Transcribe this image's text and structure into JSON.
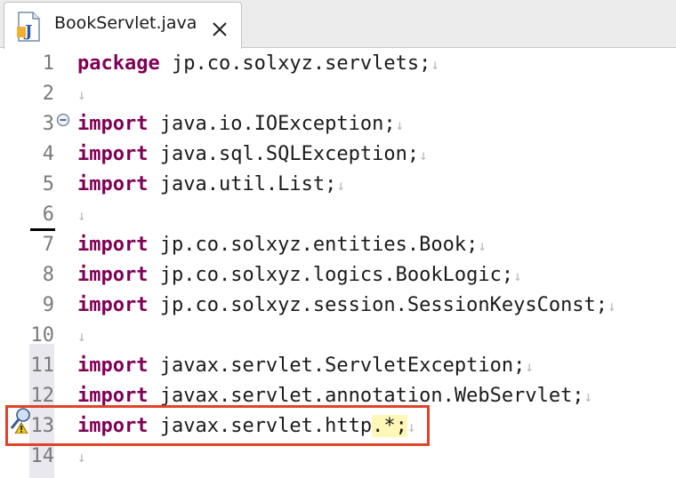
{
  "tab": {
    "title": "BookServlet.java",
    "file_icon": "java-file-icon",
    "close_icon": "close-icon"
  },
  "editor": {
    "eol_marker": "↓",
    "lines": [
      {
        "num": "1",
        "kw": "package",
        "text": " jp.co.solxyz.servlets;"
      },
      {
        "num": "2",
        "kw": "",
        "text": ""
      },
      {
        "num": "3",
        "kw": "import",
        "text": " java.io.IOException;"
      },
      {
        "num": "4",
        "kw": "import",
        "text": " java.sql.SQLException;"
      },
      {
        "num": "5",
        "kw": "import",
        "text": " java.util.List;"
      },
      {
        "num": "6",
        "kw": "",
        "text": ""
      },
      {
        "num": "7",
        "kw": "import",
        "text": " jp.co.solxyz.entities.Book;"
      },
      {
        "num": "8",
        "kw": "import",
        "text": " jp.co.solxyz.logics.BookLogic;"
      },
      {
        "num": "9",
        "kw": "import",
        "text": " jp.co.solxyz.session.SessionKeysConst;"
      },
      {
        "num": "10",
        "kw": "",
        "text": ""
      },
      {
        "num": "11",
        "kw": "import",
        "text": " javax.servlet.ServletException;"
      },
      {
        "num": "12",
        "kw": "import",
        "text": " javax.servlet.annotation.WebServlet;"
      },
      {
        "num": "13",
        "kw": "import",
        "text": " javax.servlet.http",
        "highlight": ".*;"
      },
      {
        "num": "14",
        "kw": "",
        "text": ""
      }
    ],
    "fold_icon": "collapse-icon",
    "warning_icon": "quick-fix-warning-icon"
  },
  "colors": {
    "keyword": "#7f0055",
    "annotation_box": "#e0432a",
    "highlight": "#fff7b8"
  }
}
